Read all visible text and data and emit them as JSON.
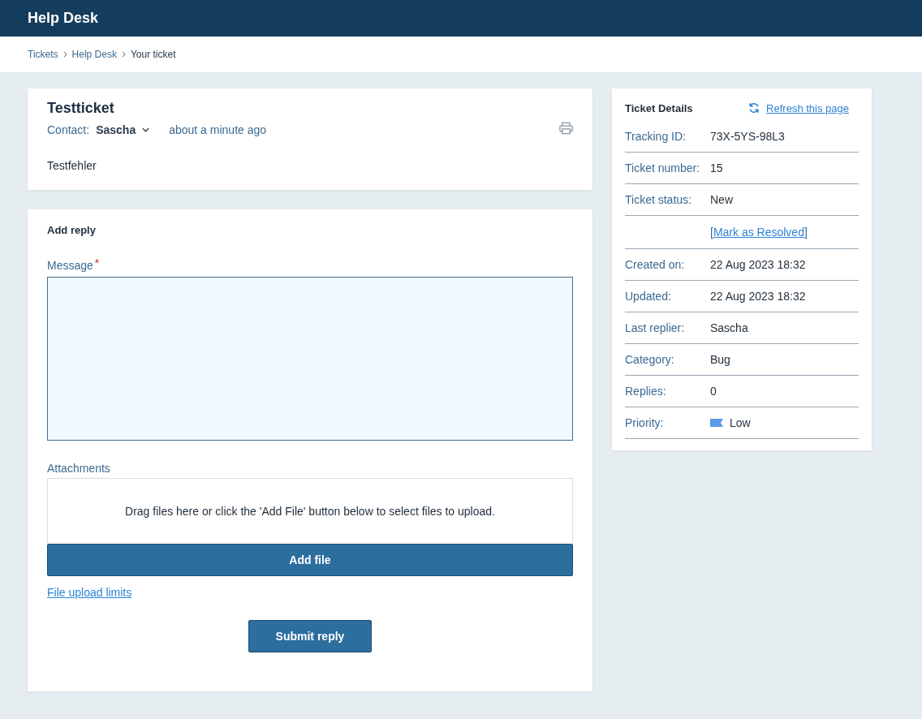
{
  "header": {
    "title": "Help Desk"
  },
  "breadcrumb": [
    {
      "label": "Tickets",
      "link": true
    },
    {
      "label": "Help Desk",
      "link": true
    },
    {
      "label": "Your ticket",
      "link": false
    }
  ],
  "ticket": {
    "subject": "Testticket",
    "contact_label": "Contact:",
    "contact_name": "Sascha",
    "time": "about a minute ago",
    "message": "Testfehler"
  },
  "reply": {
    "title": "Add reply",
    "message_label": "Message",
    "required_mark": "*",
    "attachments_label": "Attachments",
    "drop_text": "Drag files here or click the 'Add File' button below to select files to upload.",
    "add_file_button": "Add file",
    "limits_link": "File upload limits",
    "submit_button": "Submit reply"
  },
  "details": {
    "title": "Ticket Details",
    "refresh_link": "Refresh this page",
    "rows": [
      {
        "kind": "field",
        "label": "Tracking ID:",
        "value": "73X-5YS-98L3"
      },
      {
        "kind": "field",
        "label": "Ticket number:",
        "value": "15"
      },
      {
        "kind": "field",
        "label": "Ticket status:",
        "value": "New"
      },
      {
        "kind": "action",
        "before": "[",
        "link": "Mark as Resolved",
        "after": "]"
      },
      {
        "kind": "field",
        "label": "Created on:",
        "value": "22 Aug 2023 18:32"
      },
      {
        "kind": "field",
        "label": "Updated:",
        "value": "22 Aug 2023 18:32"
      },
      {
        "kind": "field",
        "label": "Last replier:",
        "value": "Sascha"
      },
      {
        "kind": "field",
        "label": "Category:",
        "value": "Bug"
      },
      {
        "kind": "field",
        "label": "Replies:",
        "value": "0"
      },
      {
        "kind": "priority",
        "label": "Priority:",
        "value": "Low",
        "color": "#5a9be8"
      }
    ]
  }
}
